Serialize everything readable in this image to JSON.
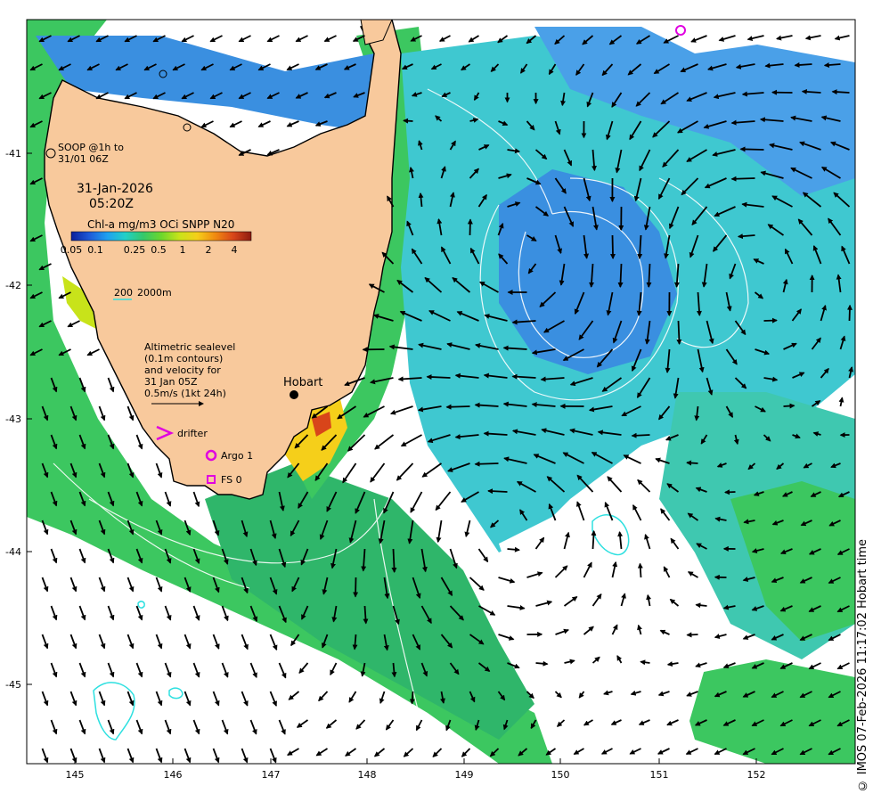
{
  "map": {
    "date": "31-Jan-2026",
    "time": "05:20Z",
    "colorbar_title": "Chl-a mg/m3 OCi SNPP N20",
    "colorbar_ticks": [
      "0.05",
      "0.1",
      "0.25",
      "0.5",
      "1",
      "2",
      "4"
    ],
    "colorbar_colors": [
      "#0a1f9c",
      "#1e5ad8",
      "#1fa0f0",
      "#21d0c8",
      "#35c86a",
      "#6cd72c",
      "#c8e31a",
      "#f5cf1a",
      "#f08a10",
      "#d8451a",
      "#8c1a10"
    ],
    "depth_legend_a": "200",
    "depth_legend_b": "2000m",
    "soop_label_1": "SOOP @1h to",
    "soop_label_2": "31/01 06Z",
    "alt_lines": [
      "Altimetric sealevel",
      "(0.1m contours)",
      "and velocity for",
      "31 Jan 05Z",
      "0.5m/s (1kt 24h)"
    ],
    "drifter_label": "drifter",
    "argo_label": "Argo 1",
    "fs_label": "FS 0",
    "city": "Hobart",
    "credit": "© IMOS 07-Feb-2026 11:17:02 Hobart time",
    "x_ticks": [
      "145",
      "146",
      "147",
      "148",
      "149",
      "150",
      "151",
      "152"
    ],
    "y_ticks": [
      "-41",
      "-42",
      "-43",
      "-44",
      "-45"
    ],
    "colors": {
      "land": "#f8c99c",
      "ocean_blue": "#3a8fe0",
      "ocean_cyan": "#3fc8d0",
      "ocean_green": "#3cc760",
      "coast_bright": "#c7e01f",
      "argo": "#e000e0",
      "depth_line": "#2ee0e0",
      "arrow": "#000000"
    }
  }
}
